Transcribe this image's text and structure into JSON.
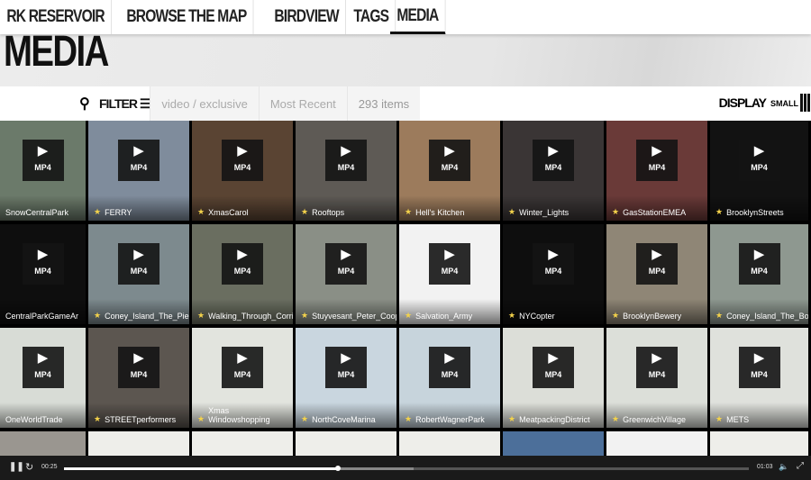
{
  "nav": {
    "tabs": [
      {
        "label": "RK RESERVOIR"
      },
      {
        "label": "BROWSE THE MAP"
      },
      {
        "label": "BIRDVIEW"
      },
      {
        "label": "TAGS"
      },
      {
        "label": "MEDIA",
        "active": true
      }
    ]
  },
  "page_title": "MEDIA",
  "toolbar": {
    "search_icon": "search-icon",
    "filter_label": "FILTER",
    "filter_icon": "hamburger-icon",
    "crumbs": [
      "video / exclusive",
      "Most Recent",
      "293 items"
    ],
    "display_label": "DISPLAY",
    "size_label": "SMALL",
    "size_icon": "grid-icon"
  },
  "badge": "MP4",
  "media": [
    [
      {
        "t": "SnowCentralPark",
        "c": "#6b7a6a",
        "s": false
      },
      {
        "t": "FERRY",
        "c": "#7f8c9c"
      },
      {
        "t": "XmasCarol",
        "c": "#5a4433"
      },
      {
        "t": "Rooftops",
        "c": "#5e5a55"
      },
      {
        "t": "Hell's Kitchen",
        "c": "#9c7b5c"
      },
      {
        "t": "Winter_Lights",
        "c": "#3a3535"
      },
      {
        "t": "GasStationEMEA",
        "c": "#6a3a38"
      },
      {
        "t": "BrooklynStreets",
        "c": "#121212"
      }
    ],
    [
      {
        "t": "CentralParkGameAr",
        "c": "#0e0e0e",
        "s": false
      },
      {
        "t": "Coney_Island_The_Pier_GoPro",
        "c": "#7d8a8e"
      },
      {
        "t": "Walking_Through_Corridors_MSG_...",
        "c": "#6a6e60"
      },
      {
        "t": "Stuyvesant_Peter_Cooper_Walk_G...",
        "c": "#8a8f86"
      },
      {
        "t": "Salvation_Army",
        "c": "#f2f2f2"
      },
      {
        "t": "NYCopter",
        "c": "#0e0e0e"
      },
      {
        "t": "BrooklynBewery",
        "c": "#8f8676"
      },
      {
        "t": "Coney_Island_The_Boardwalk",
        "c": "#8e9890"
      }
    ],
    [
      {
        "t": "OneWorldTrade",
        "c": "#d8dcd6",
        "s": false
      },
      {
        "t": "STREETperformers",
        "c": "#5c5650"
      },
      {
        "t": "Xmas Windowshopping",
        "c": "#e2e4de"
      },
      {
        "t": "NorthCoveMarina",
        "c": "#c9d6df"
      },
      {
        "t": "RobertWagnerPark",
        "c": "#c7d4dc"
      },
      {
        "t": "MeatpackingDistrict",
        "c": "#dcded8"
      },
      {
        "t": "GreenwichVillage",
        "c": "#dcdfd9"
      },
      {
        "t": "METS",
        "c": "#dfe1dc"
      }
    ],
    [
      {
        "t": "",
        "c": "#9a9690"
      },
      {
        "t": "",
        "c": "#eeeeea"
      },
      {
        "t": "",
        "c": "#eeeeea"
      },
      {
        "t": "",
        "c": "#eeeeea"
      },
      {
        "t": "",
        "c": "#eeeeea"
      },
      {
        "t": "",
        "c": "#4c6f9a"
      },
      {
        "t": "",
        "c": "#f2f2f2"
      },
      {
        "t": "",
        "c": "#eeeeea"
      }
    ]
  ],
  "player": {
    "state": "playing",
    "current_time": "00:25",
    "duration": "01:03",
    "progress_percent": 40,
    "buffered_percent": 51
  }
}
